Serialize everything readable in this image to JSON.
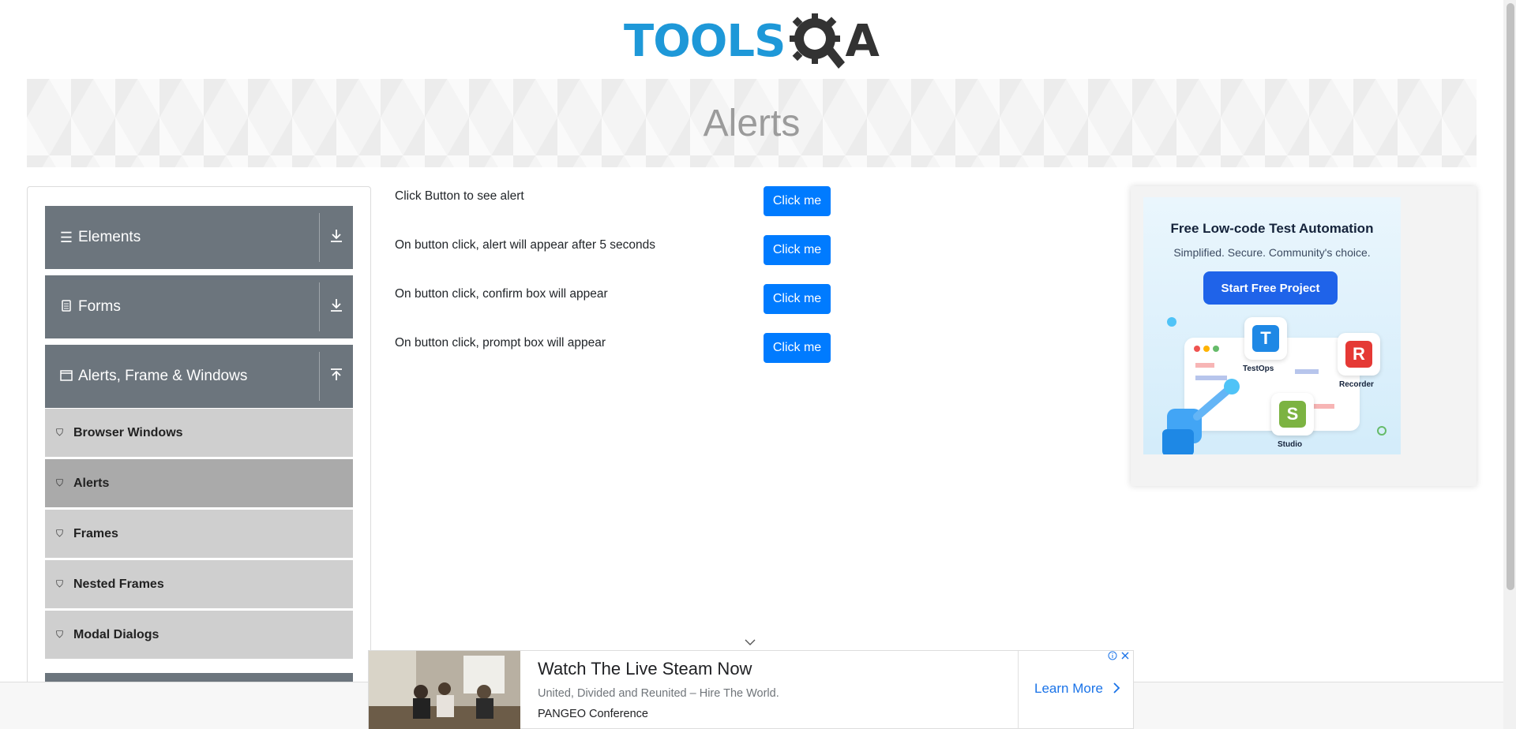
{
  "header": {
    "logo_text": "TOOLS",
    "logo_suffix": "A",
    "page_title": "Alerts",
    "colors": {
      "logo_blue": "#1e98d8",
      "logo_dark": "#333333"
    }
  },
  "sidebar": {
    "groups": [
      {
        "label": "Elements",
        "icon": "hamburger-icon",
        "toggle": "download-icon"
      },
      {
        "label": "Forms",
        "icon": "form-icon",
        "toggle": "download-icon"
      },
      {
        "label": "Alerts, Frame & Windows",
        "icon": "window-icon",
        "toggle": "upload-icon"
      }
    ],
    "items": [
      {
        "label": "Browser Windows",
        "icon": "html5-icon",
        "active": false
      },
      {
        "label": "Alerts",
        "icon": "html5-icon",
        "active": true
      },
      {
        "label": "Frames",
        "icon": "html5-icon",
        "active": false
      },
      {
        "label": "Nested Frames",
        "icon": "html5-icon",
        "active": false
      },
      {
        "label": "Modal Dialogs",
        "icon": "html5-icon",
        "active": false
      }
    ]
  },
  "main": {
    "rows": [
      {
        "text": "Click Button to see alert",
        "button": "Click me"
      },
      {
        "text": "On button click, alert will appear after 5 seconds",
        "button": "Click me"
      },
      {
        "text": "On button click, confirm box will appear",
        "button": "Click me"
      },
      {
        "text": "On button click, prompt box will appear",
        "button": "Click me"
      }
    ],
    "button_color": "#007bff"
  },
  "side_ad": {
    "title": "Free Low-code Test Automation",
    "subtitle": "Simplified. Secure. Community's choice.",
    "cta": "Start Free Project",
    "tiles": [
      {
        "label": "TestOps",
        "letter": "T",
        "color": "#1e88e5"
      },
      {
        "label": "Recorder",
        "letter": "R",
        "color": "#e53935"
      },
      {
        "label": "Studio",
        "letter": "S",
        "color": "#7cb342"
      }
    ]
  },
  "bottom_ad": {
    "title": "Watch The Live Steam Now",
    "subtitle": "United, Divided and Reunited – Hire The World.",
    "org": "PANGEO Conference",
    "cta": "Learn More",
    "choice_icons": [
      "info-icon",
      "close-icon"
    ]
  }
}
